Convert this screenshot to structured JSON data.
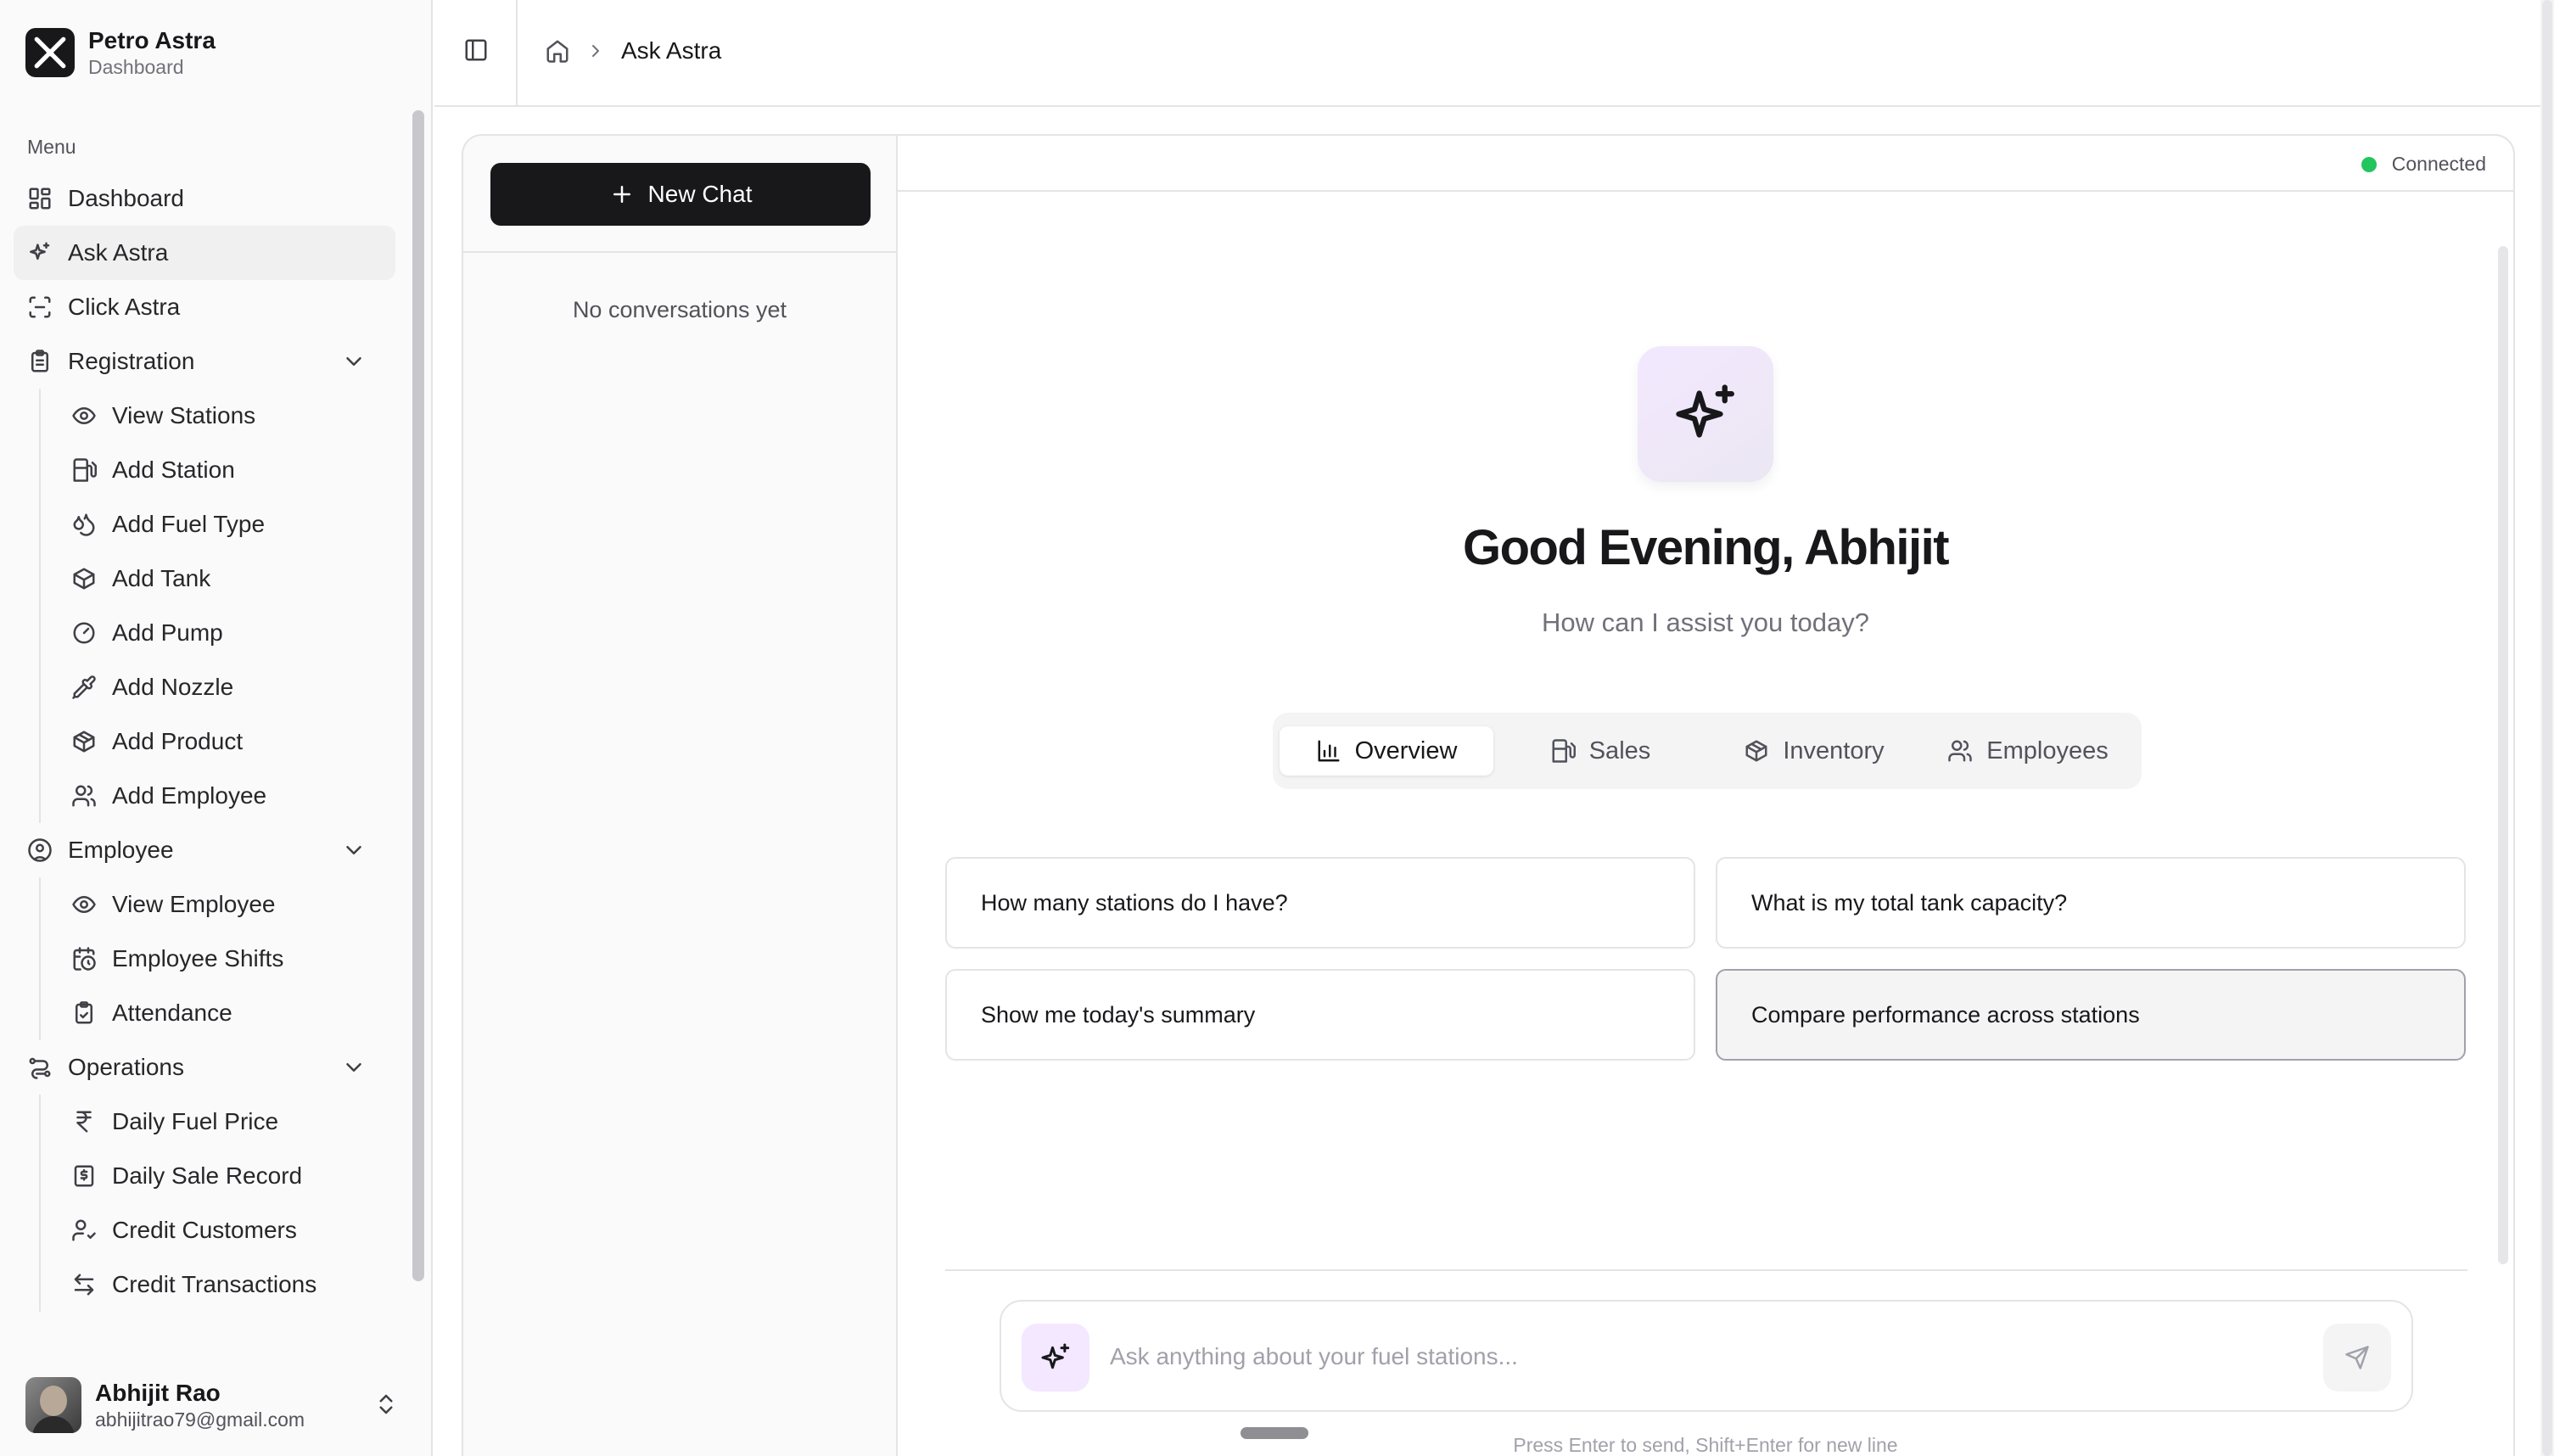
{
  "brand": {
    "name": "Petro Astra",
    "subtitle": "Dashboard"
  },
  "sidebar": {
    "menu_label": "Menu",
    "top_items": [
      {
        "label": "Dashboard",
        "icon": "dashboard-icon"
      },
      {
        "label": "Ask Astra",
        "icon": "sparkles-icon",
        "active": true
      },
      {
        "label": "Click Astra",
        "icon": "scan-icon"
      }
    ],
    "registration": {
      "label": "Registration",
      "items": [
        {
          "label": "View Stations",
          "icon": "eye-icon"
        },
        {
          "label": "Add Station",
          "icon": "fuel-icon"
        },
        {
          "label": "Add Fuel Type",
          "icon": "droplets-icon"
        },
        {
          "label": "Add Tank",
          "icon": "box-icon"
        },
        {
          "label": "Add Pump",
          "icon": "gauge-icon"
        },
        {
          "label": "Add Nozzle",
          "icon": "pipette-icon"
        },
        {
          "label": "Add Product",
          "icon": "package-icon"
        },
        {
          "label": "Add Employee",
          "icon": "users-icon"
        }
      ]
    },
    "employee": {
      "label": "Employee",
      "items": [
        {
          "label": "View Employee",
          "icon": "eye-icon"
        },
        {
          "label": "Employee Shifts",
          "icon": "calendar-clock-icon"
        },
        {
          "label": "Attendance",
          "icon": "clipboard-check-icon"
        }
      ]
    },
    "operations": {
      "label": "Operations",
      "items": [
        {
          "label": "Daily Fuel Price",
          "icon": "rupee-icon"
        },
        {
          "label": "Daily Sale Record",
          "icon": "receipt-icon"
        },
        {
          "label": "Credit Customers",
          "icon": "user-check-icon"
        },
        {
          "label": "Credit Transactions",
          "icon": "arrow-left-right-icon"
        }
      ]
    }
  },
  "user": {
    "name": "Abhijit Rao",
    "email": "abhijitrao79@gmail.com"
  },
  "header": {
    "breadcrumb_current": "Ask Astra"
  },
  "conversations": {
    "new_chat_label": "New Chat",
    "empty_text": "No conversations yet"
  },
  "chat": {
    "status": {
      "label": "Connected",
      "color": "#22c55e"
    },
    "greeting": "Good Evening, Abhijit",
    "subtitle": "How can I assist you today?",
    "tabs": [
      {
        "label": "Overview",
        "icon": "bar-chart-icon",
        "active": true
      },
      {
        "label": "Sales",
        "icon": "fuel-icon"
      },
      {
        "label": "Inventory",
        "icon": "package-icon"
      },
      {
        "label": "Employees",
        "icon": "users-icon"
      }
    ],
    "suggestions": [
      "How many stations do I have?",
      "What is my total tank capacity?",
      "Show me today's summary",
      "Compare performance across stations"
    ],
    "input_placeholder": "Ask anything about your fuel stations...",
    "hint": "Press Enter to send, Shift+Enter for new line"
  }
}
